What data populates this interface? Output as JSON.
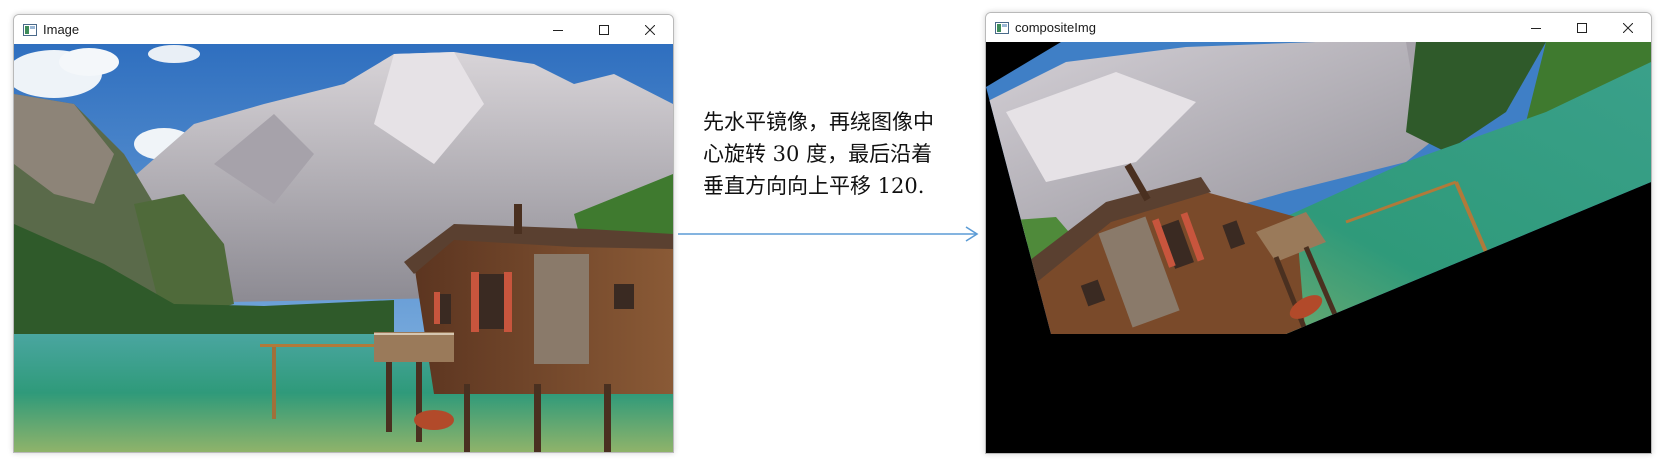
{
  "left_window": {
    "title": "Image",
    "icon": "image-app-icon"
  },
  "right_window": {
    "title": "compositeImg",
    "icon": "image-app-icon"
  },
  "window_controls": [
    "minimize-icon",
    "maximize-icon",
    "close-icon"
  ],
  "caption": {
    "line1": "先水平镜像，再绕图像中",
    "line2": "心旋转 30 度，最后沿着",
    "line3": "垂直方向向上平移 120."
  },
  "arrow": {
    "color": "#5b9bd5"
  },
  "scene": {
    "sky_color": "#3f7fc6",
    "mountain_color": "#b8b4b8",
    "lake_color": "#2fa58a",
    "house_color": "#7a4a2a",
    "shutter_color": "#c8553d"
  }
}
